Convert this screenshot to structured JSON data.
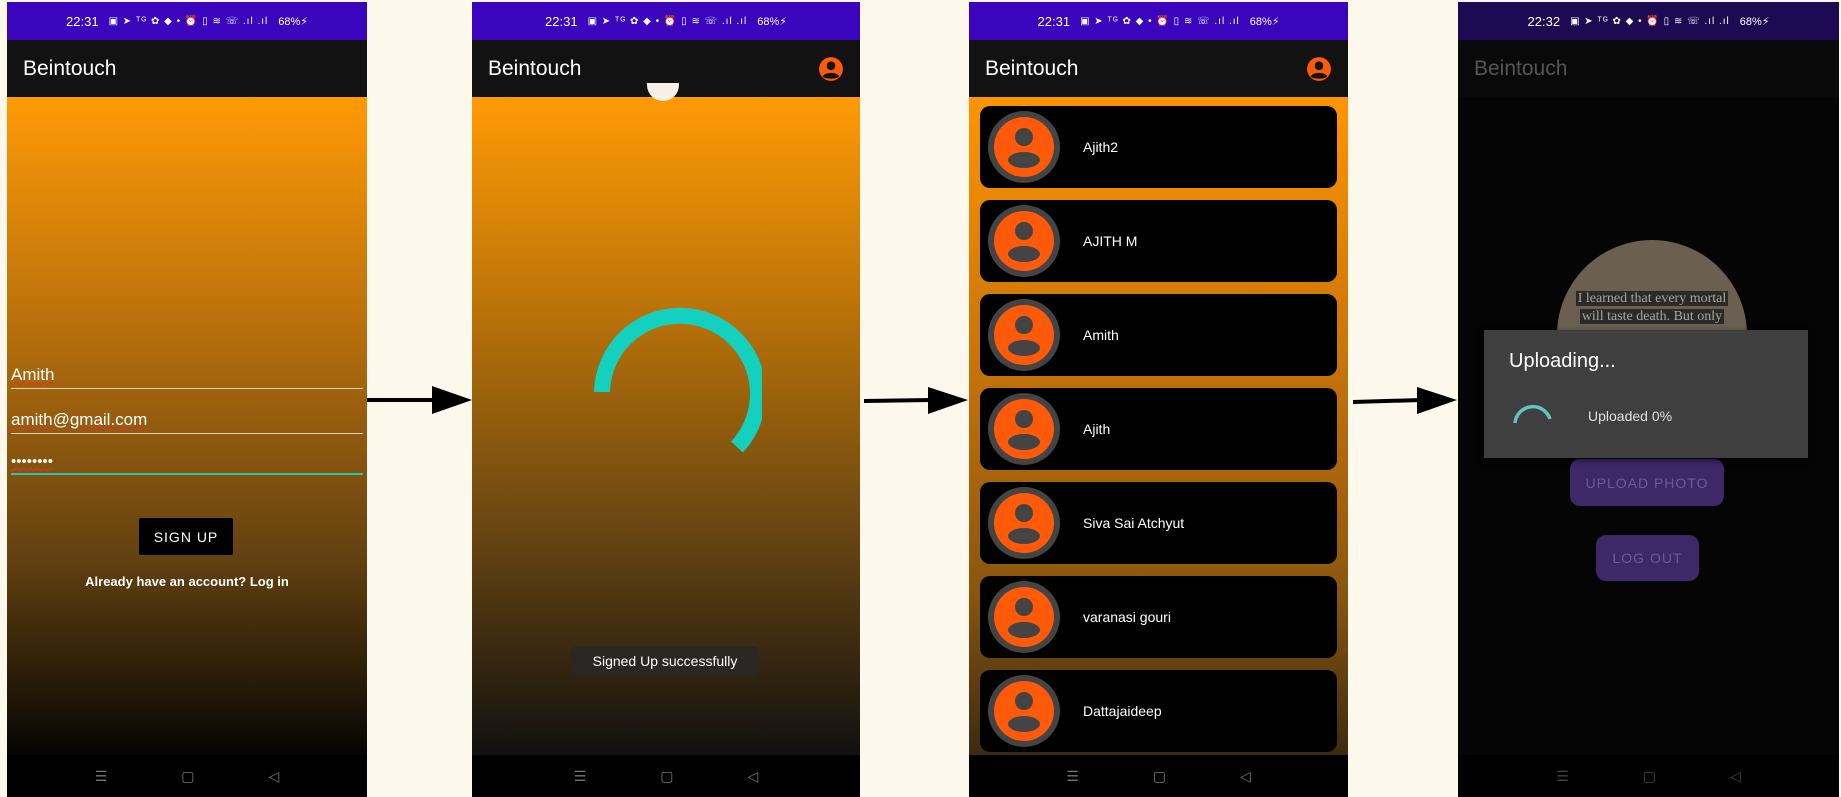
{
  "status_bars": [
    {
      "time": "22:31",
      "icons": "▣ ➤ ᵀᴳ ✿ ◆ •   ⏰ ▯ ≋ ☏ .ıl .ıl",
      "battery": "68%⚡"
    },
    {
      "time": "22:31",
      "icons": "▣ ➤ ᵀᴳ ✿ ◆ •   ⏰ ▯ ≋ ☏ .ıl .ıl",
      "battery": "68%⚡"
    },
    {
      "time": "22:31",
      "icons": "▣ ➤ ᵀᴳ ✿ ◆ •   ⏰ ▯ ≋ ☏ .ıl .ıl",
      "battery": "68%⚡"
    },
    {
      "time": "22:32",
      "icons": "▣ ➤ ᵀᴳ ✿ ◆ •   ⏰ ▯ ≋ ☏ .ıl .ıl",
      "battery": "68%⚡"
    }
  ],
  "app_title": "Beintouch",
  "nav": {
    "menu": "☰",
    "home": "▢",
    "back": "◁"
  },
  "signup": {
    "name_value": "Amith",
    "email_value": "amith@gmail.com",
    "password_value": "••••••••",
    "signup_button": "SIGN UP",
    "login_link": "Already have an account? Log in"
  },
  "loading": {
    "toast": "Signed Up successfully"
  },
  "users": [
    "Ajith2",
    "AJITH M",
    "Amith",
    "Ajith",
    "Siva Sai Atchyut",
    "varanasi gouri",
    "Dattajaideep"
  ],
  "profile": {
    "photo_text_line1": "I learned that every mortal",
    "photo_text_line2": "will taste death. But only",
    "upload_button": "UPLOAD PHOTO",
    "logout_button": "LOG OUT",
    "dialog_title": "Uploading...",
    "dialog_message": "Uploaded 0%",
    "upload_progress_percent": 0
  },
  "colors": {
    "status_bar": "#3a05bd",
    "accent_orange": "#ff9a06",
    "spinner_teal": "#14d1bf",
    "avatar_orange": "#ff5a0a"
  }
}
